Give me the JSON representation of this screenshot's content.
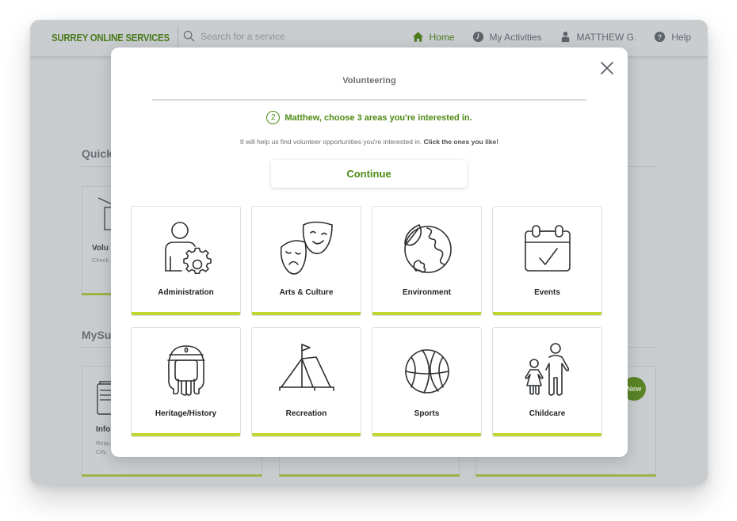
{
  "topnav": {
    "brand": "SURREY ONLINE SERVICES",
    "search_placeholder": "Search for a service",
    "links": [
      {
        "label": "Home",
        "icon": "home-icon",
        "active": true
      },
      {
        "label": "My Activities",
        "icon": "clock-icon",
        "active": false
      },
      {
        "label": "MATTHEW G.",
        "icon": "user-icon",
        "active": false
      },
      {
        "label": "Help",
        "icon": "help-icon",
        "active": false
      }
    ]
  },
  "background": {
    "quick_section_title": "Quick",
    "mysurrey_section_title": "MySu",
    "quick_card": {
      "title": "Volu",
      "desc": "Check"
    },
    "info_card": {
      "title": "Info",
      "desc_line1": "Requ",
      "desc_line2": "City."
    },
    "new_badge": "New"
  },
  "modal": {
    "title": "Volunteering",
    "step_number": "2",
    "step_text": "Matthew, choose 3 areas you're interested in.",
    "helper_text": "It will help us find volunteer opportunities you're interested in. ",
    "helper_bold": "Click the ones you like!",
    "continue_label": "Continue",
    "categories": [
      {
        "label": "Administration",
        "icon": "admin-person-gear-icon"
      },
      {
        "label": "Arts & Culture",
        "icon": "theater-masks-icon"
      },
      {
        "label": "Environment",
        "icon": "earth-leaf-icon"
      },
      {
        "label": "Events",
        "icon": "calendar-check-icon"
      },
      {
        "label": "Heritage/History",
        "icon": "pharaoh-icon"
      },
      {
        "label": "Recreation",
        "icon": "tent-flag-icon"
      },
      {
        "label": "Sports",
        "icon": "basketball-icon"
      },
      {
        "label": "Childcare",
        "icon": "adult-child-icon"
      }
    ]
  },
  "colors": {
    "brand_green": "#4c7a1d",
    "accent_green": "#4c8a14",
    "tile_accent": "#c2d631",
    "overlay_gray": "#c8cccf"
  }
}
